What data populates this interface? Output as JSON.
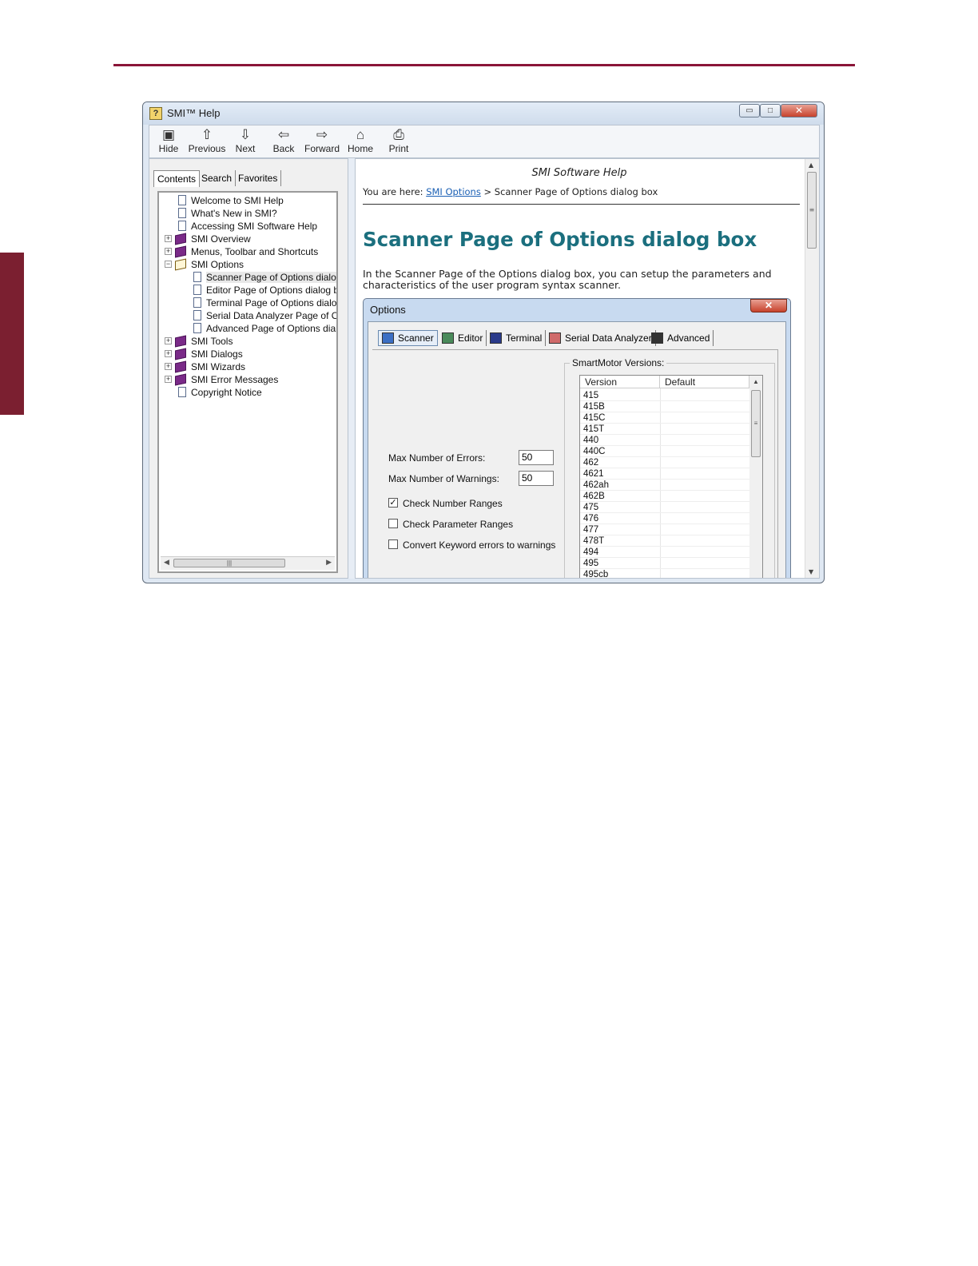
{
  "window": {
    "title": "SMI™ Help",
    "controls": {
      "minimize": "▭",
      "maximize": "□",
      "close": "✕"
    }
  },
  "toolbar": {
    "buttons": [
      {
        "label": "Hide",
        "icon": "hide-icon"
      },
      {
        "label": "Previous",
        "icon": "arrow-up-icon"
      },
      {
        "label": "Next",
        "icon": "arrow-down-icon"
      },
      {
        "label": "Back",
        "icon": "arrow-left-icon"
      },
      {
        "label": "Forward",
        "icon": "arrow-right-icon"
      },
      {
        "label": "Home",
        "icon": "home-icon"
      },
      {
        "label": "Print",
        "icon": "printer-icon"
      }
    ]
  },
  "nav": {
    "tabs": [
      "Contents",
      "Search",
      "Favorites"
    ],
    "tree": [
      {
        "label": "Welcome to SMI Help",
        "type": "page",
        "level": 1
      },
      {
        "label": "What's New in SMI?",
        "type": "page",
        "level": 1
      },
      {
        "label": "Accessing SMI Software Help",
        "type": "page",
        "level": 1
      },
      {
        "label": "SMI Overview",
        "type": "book",
        "level": 1,
        "expander": "+"
      },
      {
        "label": "Menus, Toolbar and Shortcuts",
        "type": "book",
        "level": 1,
        "expander": "+"
      },
      {
        "label": "SMI Options",
        "type": "book-open",
        "level": 1,
        "expander": "−"
      },
      {
        "label": "Scanner Page of Options dialog bo",
        "type": "page",
        "level": 2,
        "selected": true
      },
      {
        "label": "Editor Page of Options dialog box",
        "type": "page",
        "level": 2
      },
      {
        "label": "Terminal Page of Options dialog bo",
        "type": "page",
        "level": 2
      },
      {
        "label": "Serial Data Analyzer Page of Optio",
        "type": "page",
        "level": 2
      },
      {
        "label": "Advanced Page of Options dialog",
        "type": "page",
        "level": 2
      },
      {
        "label": "SMI Tools",
        "type": "book",
        "level": 1,
        "expander": "+"
      },
      {
        "label": "SMI Dialogs",
        "type": "book",
        "level": 1,
        "expander": "+"
      },
      {
        "label": "SMI Wizards",
        "type": "book",
        "level": 1,
        "expander": "+"
      },
      {
        "label": "SMI Error Messages",
        "type": "book",
        "level": 1,
        "expander": "+"
      },
      {
        "label": "Copyright Notice",
        "type": "page",
        "level": 1
      }
    ]
  },
  "content": {
    "header": "SMI Software Help",
    "breadcrumb": {
      "prefix": "You are here:",
      "link": "SMI Options",
      "separator": ">",
      "current": "Scanner Page of Options dialog box"
    },
    "heading": "Scanner Page of Options dialog box",
    "intro": "In the Scanner Page of the Options dialog box, you can setup the parameters and characteristics of the user program syntax scanner."
  },
  "dialog": {
    "title": "Options",
    "close": "✕",
    "tabs": [
      "Scanner",
      "Editor",
      "Terminal",
      "Serial Data Analyzer",
      "Advanced"
    ],
    "max_errors_label": "Max Number of Errors:",
    "max_errors_value": "50",
    "max_warnings_label": "Max Number of Warnings:",
    "max_warnings_value": "50",
    "checkboxes": [
      {
        "label": "Check Number Ranges",
        "checked": true
      },
      {
        "label": "Check Parameter Ranges",
        "checked": false
      },
      {
        "label": "Convert Keyword errors to warnings",
        "checked": false
      }
    ],
    "versions_group": "SmartMotor Versions:",
    "columns": [
      "Version",
      "Default"
    ],
    "versions": [
      "415",
      "415B",
      "415C",
      "415T",
      "440",
      "440C",
      "462",
      "4621",
      "462ah",
      "462B",
      "475",
      "476",
      "477",
      "478T",
      "494",
      "495",
      "495cb"
    ]
  }
}
